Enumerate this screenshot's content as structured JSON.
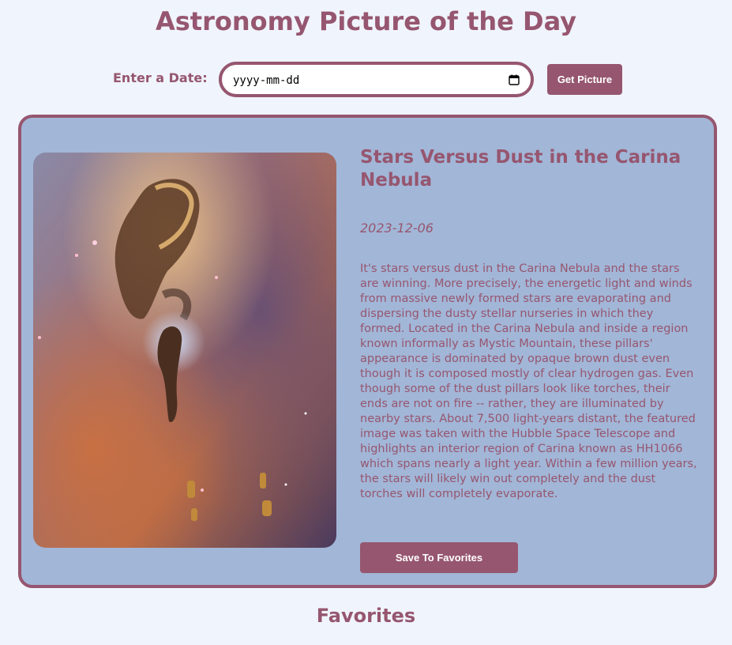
{
  "header": {
    "title": "Astronomy Picture of the Day"
  },
  "date_picker": {
    "label": "Enter a Date:",
    "placeholder": "yyyy-mm-dd",
    "value": "",
    "button_label": "Get Picture",
    "icon": "calendar-icon"
  },
  "apod": {
    "image_alt": "Stars Versus Dust in the Carina Nebula",
    "title": "Stars Versus Dust in the Carina Nebula",
    "date": "2023-12-06",
    "explanation": "It's stars versus dust in the Carina Nebula and the stars are winning. More precisely, the energetic light and winds from massive newly formed stars are evaporating and dispersing the dusty stellar nurseries in which they formed. Located in the Carina Nebula and inside a region known informally as Mystic Mountain, these pillars' appearance is dominated by opaque brown dust even though it is composed mostly of clear hydrogen gas. Even though some of the dust pillars look like torches, their ends are not on fire -- rather, they are illuminated by nearby stars. About 7,500 light-years distant, the featured image was taken with the Hubble Space Telescope and highlights an interior region of Carina known as HH1066 which spans nearly a light year. Within a few million years, the stars will likely win out completely and the dust torches will completely evaporate.",
    "save_label": "Save To Favorites"
  },
  "favorites": {
    "heading": "Favorites"
  },
  "colors": {
    "accent": "#96566f",
    "card_background": "#a2b6d7",
    "page_background": "#f0f4fd"
  }
}
